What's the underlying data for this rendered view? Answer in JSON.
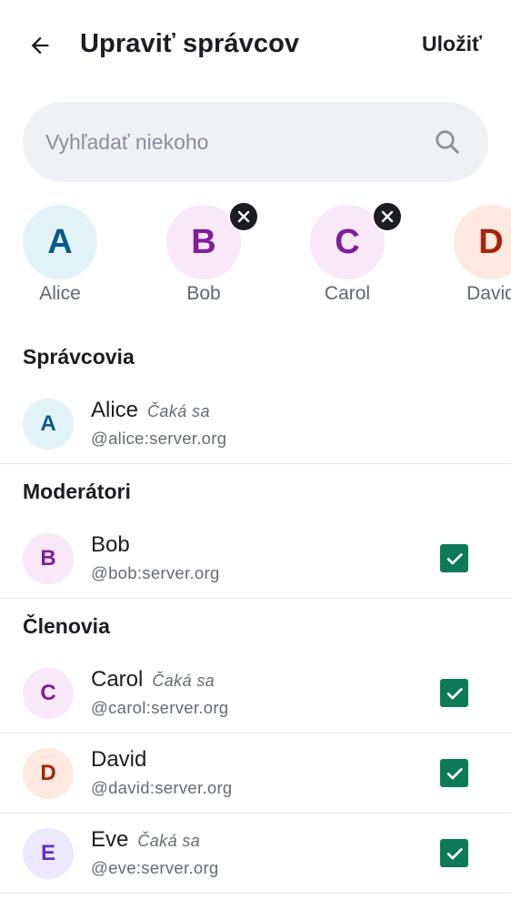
{
  "header": {
    "title": "Upraviť správcov",
    "save_label": "Uložiť"
  },
  "search": {
    "placeholder": "Vyhľadať niekoho",
    "value": ""
  },
  "selected_chips": [
    {
      "initial": "A",
      "name": "Alice",
      "removable": false,
      "bg": "#e2f3f8",
      "fg": "#0a5989"
    },
    {
      "initial": "B",
      "name": "Bob",
      "removable": true,
      "bg": "#f9e8f8",
      "fg": "#7e1e9b"
    },
    {
      "initial": "C",
      "name": "Carol",
      "removable": true,
      "bg": "#f9e8f8",
      "fg": "#7e1e9b"
    },
    {
      "initial": "D",
      "name": "David",
      "removable": true,
      "bg": "#fde9e0",
      "fg": "#a4250b"
    }
  ],
  "sections": {
    "admins": "Správcovia",
    "moderators": "Moderátori",
    "members": "Členovia"
  },
  "users": {
    "alice": {
      "initial": "A",
      "name": "Alice",
      "pending": "Čaká sa",
      "id": "@alice:server.org",
      "bg": "#e2f3f8",
      "fg": "#0a5989"
    },
    "bob": {
      "initial": "B",
      "name": "Bob",
      "pending": "",
      "id": "@bob:server.org",
      "checked": true,
      "bg": "#f9e8f8",
      "fg": "#7e1e9b"
    },
    "carol": {
      "initial": "C",
      "name": "Carol",
      "pending": "Čaká sa",
      "id": "@carol:server.org",
      "checked": true,
      "bg": "#f9e8f8",
      "fg": "#7e1e9b"
    },
    "david": {
      "initial": "D",
      "name": "David",
      "pending": "",
      "id": "@david:server.org",
      "checked": true,
      "bg": "#fde9e0",
      "fg": "#a4250b"
    },
    "eve": {
      "initial": "E",
      "name": "Eve",
      "pending": "Čaká sa",
      "id": "@eve:server.org",
      "checked": true,
      "bg": "#ede8fc",
      "fg": "#5d32c8"
    }
  },
  "colors": {
    "accent_check": "#0c7a57",
    "search_bg": "#eff1f4",
    "text_primary": "#1b1d22",
    "text_secondary": "#656a73"
  },
  "icons": {
    "back": "arrow-left-icon",
    "search": "search-icon",
    "remove": "close-icon",
    "check": "checkmark-icon"
  }
}
